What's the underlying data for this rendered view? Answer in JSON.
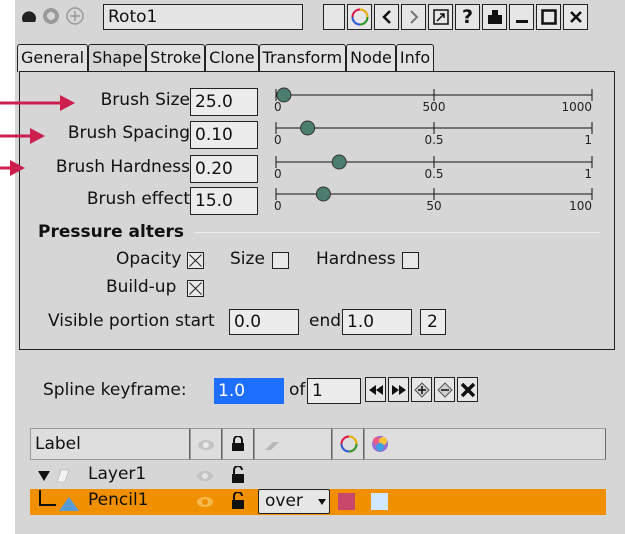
{
  "window": {
    "title": "Roto1",
    "help_label": "?"
  },
  "tabs": [
    "General",
    "Shape",
    "Stroke",
    "Clone",
    "Transform",
    "Node",
    "Info"
  ],
  "active_tab": "Shape",
  "sliders": [
    {
      "label": "Brush Size",
      "value": "25.0",
      "ticks": [
        "0",
        "500",
        "1000"
      ],
      "fraction": 0.025
    },
    {
      "label": "Brush Spacing",
      "value": "0.10",
      "ticks": [
        "0",
        "0.5",
        "1"
      ],
      "fraction": 0.1
    },
    {
      "label": "Brush Hardness",
      "value": "0.20",
      "ticks": [
        "0",
        "0.5",
        "1"
      ],
      "fraction": 0.2
    },
    {
      "label": "Brush effect",
      "value": "15.0",
      "ticks": [
        "0",
        "50",
        "100"
      ],
      "fraction": 0.15
    }
  ],
  "pressure": {
    "title": "Pressure alters",
    "opacity_label": "Opacity",
    "opacity_checked": true,
    "size_label": "Size",
    "size_checked": false,
    "hardness_label": "Hardness",
    "hardness_checked": false,
    "buildup_label": "Build-up",
    "buildup_checked": true
  },
  "visible_portion": {
    "label": "Visible portion start",
    "start": "0.0",
    "end_label": "end",
    "end": "1.0",
    "count": "2"
  },
  "keyframe": {
    "label": "Spline keyframe:",
    "value": "1.0",
    "of_label": "of",
    "total": "1"
  },
  "table": {
    "label_header": "Label",
    "rows": [
      {
        "name": "Layer1",
        "type": "layer",
        "expanded": true,
        "selected": false
      },
      {
        "name": "Pencil1",
        "type": "stroke",
        "blend": "over",
        "selected": true,
        "color": "#c8476a",
        "overlay_color": "#cfe8ff"
      }
    ]
  },
  "colors": {
    "accent_arrow": "#cc1f4d",
    "selection": "#f09000",
    "keyframe_input": "#1e6fff",
    "slider_knob": "#4d7d6e"
  }
}
